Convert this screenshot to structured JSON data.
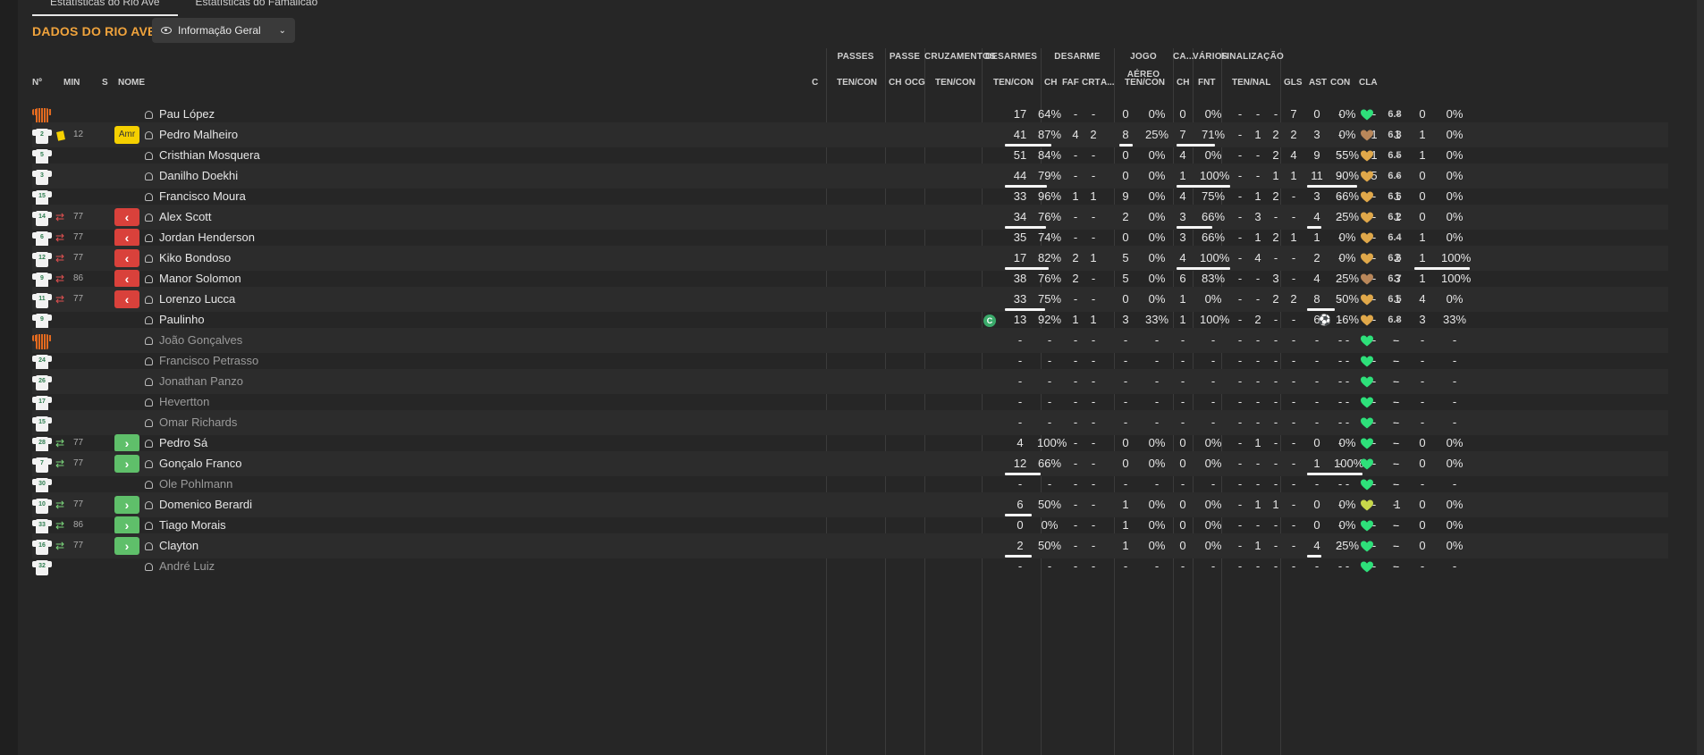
{
  "tabs": [
    "Estatísticas do Rio Ave",
    "Estatísticas do Famalicão"
  ],
  "header": {
    "title": "DADOS DO RIO AVE",
    "view": "Informação Geral"
  },
  "group_headers": [
    "PASSES",
    "PASSE",
    "CRUZAMENTOS",
    "DESARMES",
    "DESARME",
    "JOGO AÉREO",
    "CA...",
    "VÁRIOS",
    "FINALIZAÇÃO"
  ],
  "columns": [
    "Nº",
    "MIN",
    "S",
    "NOME",
    "C",
    "TEN/CON",
    "CH",
    "OCG",
    "TEN/CON",
    "TEN/CON",
    "CH",
    "FAF",
    "CRT",
    "A...",
    "TEN/CON",
    "CH",
    "FNT",
    "TEN/NAL",
    "GLS",
    "AST",
    "CON",
    "CLA"
  ],
  "players": [
    {
      "num": "1",
      "kit": "gk",
      "card": false,
      "min": "",
      "status": "",
      "name": "Pau López",
      "capt": false,
      "pas": [
        "17",
        "64%"
      ],
      "pas_pct": 0.64,
      "pch": "-",
      "pocg": "-",
      "cru": [
        "0",
        "0%"
      ],
      "cru_pct": 0,
      "des": [
        "0",
        "0%"
      ],
      "des_pct": 0,
      "dch": "-",
      "faf": "-",
      "crt": "-",
      "a": "7",
      "aer": [
        "0",
        "0%"
      ],
      "aer_pct": 0,
      "cach": "-",
      "fnt": "-",
      "fin": [
        "0",
        "0%"
      ],
      "fin_pct": 0,
      "gls": "",
      "ast": "-",
      "con": "great",
      "cla": "6.8"
    },
    {
      "num": "2",
      "kit": "out",
      "card": true,
      "min": "12",
      "status": "Amr",
      "name": "Pedro Malheiro",
      "capt": false,
      "pas": [
        "41",
        "87%"
      ],
      "pas_pct": 0.87,
      "pch": "4",
      "pocg": "2",
      "cru": [
        "8",
        "25%"
      ],
      "cru_pct": 0.25,
      "des": [
        "7",
        "71%"
      ],
      "des_pct": 0.71,
      "dch": "-",
      "faf": "1",
      "crt": "2",
      "a": "2",
      "aer": [
        "3",
        "0%"
      ],
      "aer_pct": 0,
      "cach": "1",
      "fnt": "1",
      "fin": [
        "1",
        "0%"
      ],
      "fin_pct": 0,
      "gls": "",
      "ast": "-",
      "con": "poor",
      "cla": "6.8"
    },
    {
      "num": "5",
      "kit": "out",
      "card": false,
      "min": "",
      "status": "",
      "name": "Cristhian Mosquera",
      "capt": false,
      "pas": [
        "51",
        "84%"
      ],
      "pas_pct": 0.84,
      "pch": "-",
      "pocg": "-",
      "cru": [
        "0",
        "0%"
      ],
      "cru_pct": 0,
      "des": [
        "4",
        "0%"
      ],
      "des_pct": 0,
      "dch": "-",
      "faf": "-",
      "crt": "2",
      "a": "4",
      "aer": [
        "9",
        "55%"
      ],
      "aer_pct": 0.55,
      "cach": "1",
      "fnt": "-",
      "fin": [
        "1",
        "0%"
      ],
      "fin_pct": 0,
      "gls": "",
      "ast": "-",
      "con": "ok",
      "cla": "6.5"
    },
    {
      "num": "3",
      "kit": "out",
      "card": false,
      "min": "",
      "status": "",
      "name": "Danilho Doekhi",
      "capt": false,
      "pas": [
        "44",
        "79%"
      ],
      "pas_pct": 0.79,
      "pch": "-",
      "pocg": "-",
      "cru": [
        "0",
        "0%"
      ],
      "cru_pct": 0,
      "des": [
        "1",
        "100%"
      ],
      "des_pct": 1,
      "dch": "-",
      "faf": "-",
      "crt": "1",
      "a": "1",
      "aer": [
        "11",
        "90%"
      ],
      "aer_pct": 0.9,
      "cach": "5",
      "fnt": "-",
      "fin": [
        "0",
        "0%"
      ],
      "fin_pct": 0,
      "gls": "",
      "ast": "-",
      "con": "ok",
      "cla": "6.6"
    },
    {
      "num": "15",
      "kit": "out",
      "card": false,
      "min": "",
      "status": "",
      "name": "Francisco Moura",
      "capt": false,
      "pas": [
        "33",
        "96%"
      ],
      "pas_pct": 0.96,
      "pch": "1",
      "pocg": "1",
      "cru": [
        "9",
        "0%"
      ],
      "cru_pct": 0,
      "des": [
        "4",
        "75%"
      ],
      "des_pct": 0.75,
      "dch": "-",
      "faf": "1",
      "crt": "2",
      "a": "-",
      "aer": [
        "3",
        "66%"
      ],
      "aer_pct": 0.66,
      "cach": "-",
      "fnt": "1",
      "fin": [
        "0",
        "0%"
      ],
      "fin_pct": 0,
      "gls": "",
      "ast": "-",
      "con": "ok",
      "cla": "6.6"
    },
    {
      "num": "14",
      "kit": "out",
      "card": false,
      "min": "77",
      "status": "off",
      "name": "Alex Scott",
      "capt": false,
      "pas": [
        "34",
        "76%"
      ],
      "pas_pct": 0.76,
      "pch": "-",
      "pocg": "-",
      "cru": [
        "2",
        "0%"
      ],
      "cru_pct": 0,
      "des": [
        "3",
        "66%"
      ],
      "des_pct": 0.66,
      "dch": "-",
      "faf": "3",
      "crt": "-",
      "a": "-",
      "aer": [
        "4",
        "25%"
      ],
      "aer_pct": 0.25,
      "cach": "-",
      "fnt": "1",
      "fin": [
        "0",
        "0%"
      ],
      "fin_pct": 0,
      "gls": "",
      "ast": "-",
      "con": "ok",
      "cla": "6.2"
    },
    {
      "num": "6",
      "kit": "out",
      "card": false,
      "min": "77",
      "status": "off",
      "name": "Jordan Henderson",
      "capt": false,
      "pas": [
        "35",
        "74%"
      ],
      "pas_pct": 0.74,
      "pch": "-",
      "pocg": "-",
      "cru": [
        "0",
        "0%"
      ],
      "cru_pct": 0,
      "des": [
        "3",
        "66%"
      ],
      "des_pct": 0.66,
      "dch": "-",
      "faf": "1",
      "crt": "2",
      "a": "1",
      "aer": [
        "1",
        "0%"
      ],
      "aer_pct": 0,
      "cach": "-",
      "fnt": "-",
      "fin": [
        "1",
        "0%"
      ],
      "fin_pct": 0,
      "gls": "",
      "ast": "-",
      "con": "ok",
      "cla": "6.4"
    },
    {
      "num": "12",
      "kit": "out",
      "card": false,
      "min": "77",
      "status": "off",
      "name": "Kiko Bondoso",
      "capt": false,
      "pas": [
        "17",
        "82%"
      ],
      "pas_pct": 0.82,
      "pch": "2",
      "pocg": "1",
      "cru": [
        "5",
        "0%"
      ],
      "cru_pct": 0,
      "des": [
        "4",
        "100%"
      ],
      "des_pct": 1,
      "dch": "-",
      "faf": "4",
      "crt": "-",
      "a": "-",
      "aer": [
        "2",
        "0%"
      ],
      "aer_pct": 0,
      "cach": "-",
      "fnt": "2",
      "fin": [
        "1",
        "100%"
      ],
      "fin_pct": 1,
      "gls": "",
      "ast": "-",
      "con": "ok",
      "cla": "6.6"
    },
    {
      "num": "9",
      "kit": "out",
      "card": false,
      "min": "86",
      "status": "off",
      "name": "Manor Solomon",
      "capt": false,
      "pas": [
        "38",
        "76%"
      ],
      "pas_pct": 0.76,
      "pch": "2",
      "pocg": "-",
      "cru": [
        "5",
        "0%"
      ],
      "cru_pct": 0,
      "des": [
        "6",
        "83%"
      ],
      "des_pct": 0.83,
      "dch": "-",
      "faf": "-",
      "crt": "3",
      "a": "-",
      "aer": [
        "4",
        "25%"
      ],
      "aer_pct": 0.25,
      "cach": "-",
      "fnt": "3",
      "fin": [
        "1",
        "100%"
      ],
      "fin_pct": 1,
      "gls": "",
      "ast": "-",
      "con": "poor",
      "cla": "6.7"
    },
    {
      "num": "11",
      "kit": "out",
      "card": false,
      "min": "77",
      "status": "off",
      "name": "Lorenzo Lucca",
      "capt": false,
      "pas": [
        "33",
        "75%"
      ],
      "pas_pct": 0.75,
      "pch": "-",
      "pocg": "-",
      "cru": [
        "0",
        "0%"
      ],
      "cru_pct": 0,
      "des": [
        "1",
        "0%"
      ],
      "des_pct": 0,
      "dch": "-",
      "faf": "-",
      "crt": "2",
      "a": "2",
      "aer": [
        "8",
        "50%"
      ],
      "aer_pct": 0.5,
      "cach": "-",
      "fnt": "1",
      "fin": [
        "4",
        "0%"
      ],
      "fin_pct": 0,
      "gls": "",
      "ast": "-",
      "con": "ok",
      "cla": "6.5"
    },
    {
      "num": "9",
      "kit": "out",
      "card": false,
      "min": "",
      "status": "",
      "name": "Paulinho",
      "capt": true,
      "pas": [
        "13",
        "92%"
      ],
      "pas_pct": 0.92,
      "pch": "1",
      "pocg": "1",
      "cru": [
        "3",
        "33%"
      ],
      "cru_pct": 0.33,
      "des": [
        "1",
        "100%"
      ],
      "des_pct": 1,
      "dch": "-",
      "faf": "2",
      "crt": "-",
      "a": "-",
      "aer": [
        "6",
        "16%"
      ],
      "aer_pct": 0.16,
      "cach": "-",
      "fnt": "-",
      "fin": [
        "3",
        "33%"
      ],
      "fin_pct": 0.33,
      "gls": "ball",
      "ast": "-",
      "con": "ok",
      "cla": "6.8"
    },
    {
      "num": "",
      "kit": "gk",
      "card": false,
      "min": "",
      "status": "",
      "name": "João Gonçalves",
      "capt": false,
      "pas": [
        "-",
        "-"
      ],
      "pas_pct": 0,
      "pch": "-",
      "pocg": "-",
      "cru": [
        "-",
        "-"
      ],
      "cru_pct": 0,
      "des": [
        "-",
        "-"
      ],
      "des_pct": 0,
      "dch": "-",
      "faf": "-",
      "crt": "-",
      "a": "-",
      "aer": [
        "-",
        "-"
      ],
      "aer_pct": 0,
      "cach": "-",
      "fnt": "-",
      "fin": [
        "-",
        "-"
      ],
      "fin_pct": 0,
      "gls": "",
      "ast": "-",
      "con": "great",
      "cla": "-"
    },
    {
      "num": "24",
      "kit": "out",
      "card": false,
      "min": "",
      "status": "",
      "name": "Francisco Petrasso",
      "capt": false,
      "pas": [
        "-",
        "-"
      ],
      "pas_pct": 0,
      "pch": "-",
      "pocg": "-",
      "cru": [
        "-",
        "-"
      ],
      "cru_pct": 0,
      "des": [
        "-",
        "-"
      ],
      "des_pct": 0,
      "dch": "-",
      "faf": "-",
      "crt": "-",
      "a": "-",
      "aer": [
        "-",
        "-"
      ],
      "aer_pct": 0,
      "cach": "-",
      "fnt": "-",
      "fin": [
        "-",
        "-"
      ],
      "fin_pct": 0,
      "gls": "",
      "ast": "-",
      "con": "great",
      "cla": "-"
    },
    {
      "num": "26",
      "kit": "out",
      "card": false,
      "min": "",
      "status": "",
      "name": "Jonathan Panzo",
      "capt": false,
      "pas": [
        "-",
        "-"
      ],
      "pas_pct": 0,
      "pch": "-",
      "pocg": "-",
      "cru": [
        "-",
        "-"
      ],
      "cru_pct": 0,
      "des": [
        "-",
        "-"
      ],
      "des_pct": 0,
      "dch": "-",
      "faf": "-",
      "crt": "-",
      "a": "-",
      "aer": [
        "-",
        "-"
      ],
      "aer_pct": 0,
      "cach": "-",
      "fnt": "-",
      "fin": [
        "-",
        "-"
      ],
      "fin_pct": 0,
      "gls": "",
      "ast": "-",
      "con": "great",
      "cla": "-"
    },
    {
      "num": "17",
      "kit": "out",
      "card": false,
      "min": "",
      "status": "",
      "name": "Hevertton",
      "capt": false,
      "pas": [
        "-",
        "-"
      ],
      "pas_pct": 0,
      "pch": "-",
      "pocg": "-",
      "cru": [
        "-",
        "-"
      ],
      "cru_pct": 0,
      "des": [
        "-",
        "-"
      ],
      "des_pct": 0,
      "dch": "-",
      "faf": "-",
      "crt": "-",
      "a": "-",
      "aer": [
        "-",
        "-"
      ],
      "aer_pct": 0,
      "cach": "-",
      "fnt": "-",
      "fin": [
        "-",
        "-"
      ],
      "fin_pct": 0,
      "gls": "",
      "ast": "-",
      "con": "great",
      "cla": "-"
    },
    {
      "num": "15",
      "kit": "out",
      "card": false,
      "min": "",
      "status": "",
      "name": "Omar Richards",
      "capt": false,
      "pas": [
        "-",
        "-"
      ],
      "pas_pct": 0,
      "pch": "-",
      "pocg": "-",
      "cru": [
        "-",
        "-"
      ],
      "cru_pct": 0,
      "des": [
        "-",
        "-"
      ],
      "des_pct": 0,
      "dch": "-",
      "faf": "-",
      "crt": "-",
      "a": "-",
      "aer": [
        "-",
        "-"
      ],
      "aer_pct": 0,
      "cach": "-",
      "fnt": "-",
      "fin": [
        "-",
        "-"
      ],
      "fin_pct": 0,
      "gls": "",
      "ast": "-",
      "con": "great",
      "cla": "-"
    },
    {
      "num": "28",
      "kit": "out",
      "card": false,
      "min": "77",
      "status": "on",
      "name": "Pedro Sá",
      "capt": false,
      "pas": [
        "4",
        "100%"
      ],
      "pas_pct": 1,
      "pch": "-",
      "pocg": "-",
      "cru": [
        "0",
        "0%"
      ],
      "cru_pct": 0,
      "des": [
        "0",
        "0%"
      ],
      "des_pct": 0,
      "dch": "-",
      "faf": "1",
      "crt": "-",
      "a": "-",
      "aer": [
        "0",
        "0%"
      ],
      "aer_pct": 0,
      "cach": "-",
      "fnt": "-",
      "fin": [
        "0",
        "0%"
      ],
      "fin_pct": 0,
      "gls": "",
      "ast": "-",
      "con": "great",
      "cla": "-"
    },
    {
      "num": "7",
      "kit": "out",
      "card": false,
      "min": "77",
      "status": "on",
      "name": "Gonçalo Franco",
      "capt": false,
      "pas": [
        "12",
        "66%"
      ],
      "pas_pct": 0.66,
      "pch": "-",
      "pocg": "-",
      "cru": [
        "0",
        "0%"
      ],
      "cru_pct": 0,
      "des": [
        "0",
        "0%"
      ],
      "des_pct": 0,
      "dch": "-",
      "faf": "-",
      "crt": "-",
      "a": "-",
      "aer": [
        "1",
        "100%"
      ],
      "aer_pct": 1,
      "cach": "-",
      "fnt": "-",
      "fin": [
        "0",
        "0%"
      ],
      "fin_pct": 0,
      "gls": "",
      "ast": "-",
      "con": "great",
      "cla": "-"
    },
    {
      "num": "30",
      "kit": "out",
      "card": false,
      "min": "",
      "status": "",
      "name": "Ole Pohlmann",
      "capt": false,
      "pas": [
        "-",
        "-"
      ],
      "pas_pct": 0,
      "pch": "-",
      "pocg": "-",
      "cru": [
        "-",
        "-"
      ],
      "cru_pct": 0,
      "des": [
        "-",
        "-"
      ],
      "des_pct": 0,
      "dch": "-",
      "faf": "-",
      "crt": "-",
      "a": "-",
      "aer": [
        "-",
        "-"
      ],
      "aer_pct": 0,
      "cach": "-",
      "fnt": "-",
      "fin": [
        "-",
        "-"
      ],
      "fin_pct": 0,
      "gls": "",
      "ast": "-",
      "con": "great",
      "cla": "-"
    },
    {
      "num": "10",
      "kit": "out",
      "card": false,
      "min": "77",
      "status": "on",
      "name": "Domenico Berardi",
      "capt": false,
      "pas": [
        "6",
        "50%"
      ],
      "pas_pct": 0.5,
      "pch": "-",
      "pocg": "-",
      "cru": [
        "1",
        "0%"
      ],
      "cru_pct": 0,
      "des": [
        "0",
        "0%"
      ],
      "des_pct": 0,
      "dch": "-",
      "faf": "1",
      "crt": "1",
      "a": "-",
      "aer": [
        "0",
        "0%"
      ],
      "aer_pct": 0,
      "cach": "-",
      "fnt": "1",
      "fin": [
        "0",
        "0%"
      ],
      "fin_pct": 0,
      "gls": "",
      "ast": "-",
      "con": "good",
      "cla": "-"
    },
    {
      "num": "33",
      "kit": "out",
      "card": false,
      "min": "86",
      "status": "on",
      "name": "Tiago Morais",
      "capt": false,
      "pas": [
        "0",
        "0%"
      ],
      "pas_pct": 0,
      "pch": "-",
      "pocg": "-",
      "cru": [
        "1",
        "0%"
      ],
      "cru_pct": 0,
      "des": [
        "0",
        "0%"
      ],
      "des_pct": 0,
      "dch": "-",
      "faf": "-",
      "crt": "-",
      "a": "-",
      "aer": [
        "0",
        "0%"
      ],
      "aer_pct": 0,
      "cach": "-",
      "fnt": "-",
      "fin": [
        "0",
        "0%"
      ],
      "fin_pct": 0,
      "gls": "",
      "ast": "-",
      "con": "great",
      "cla": "-"
    },
    {
      "num": "16",
      "kit": "out",
      "card": false,
      "min": "77",
      "status": "on",
      "name": "Clayton",
      "capt": false,
      "pas": [
        "2",
        "50%"
      ],
      "pas_pct": 0.5,
      "pch": "-",
      "pocg": "-",
      "cru": [
        "1",
        "0%"
      ],
      "cru_pct": 0,
      "des": [
        "0",
        "0%"
      ],
      "des_pct": 0,
      "dch": "-",
      "faf": "1",
      "crt": "-",
      "a": "-",
      "aer": [
        "4",
        "25%"
      ],
      "aer_pct": 0.25,
      "cach": "-",
      "fnt": "-",
      "fin": [
        "0",
        "0%"
      ],
      "fin_pct": 0,
      "gls": "",
      "ast": "-",
      "con": "great",
      "cla": "-"
    },
    {
      "num": "32",
      "kit": "out",
      "card": false,
      "min": "",
      "status": "",
      "name": "André Luiz",
      "capt": false,
      "pas": [
        "-",
        "-"
      ],
      "pas_pct": 0,
      "pch": "-",
      "pocg": "-",
      "cru": [
        "-",
        "-"
      ],
      "cru_pct": 0,
      "des": [
        "-",
        "-"
      ],
      "des_pct": 0,
      "dch": "-",
      "faf": "-",
      "crt": "-",
      "a": "-",
      "aer": [
        "-",
        "-"
      ],
      "aer_pct": 0,
      "cach": "-",
      "fnt": "-",
      "fin": [
        "-",
        "-"
      ],
      "fin_pct": 0,
      "gls": "",
      "ast": "-",
      "con": "great",
      "cla": "-"
    }
  ],
  "colors": {
    "title": "#f0a33c",
    "great": "#2ee07a",
    "good": "#c7d84a",
    "ok": "#e0a84a",
    "poor": "#b9875a"
  }
}
